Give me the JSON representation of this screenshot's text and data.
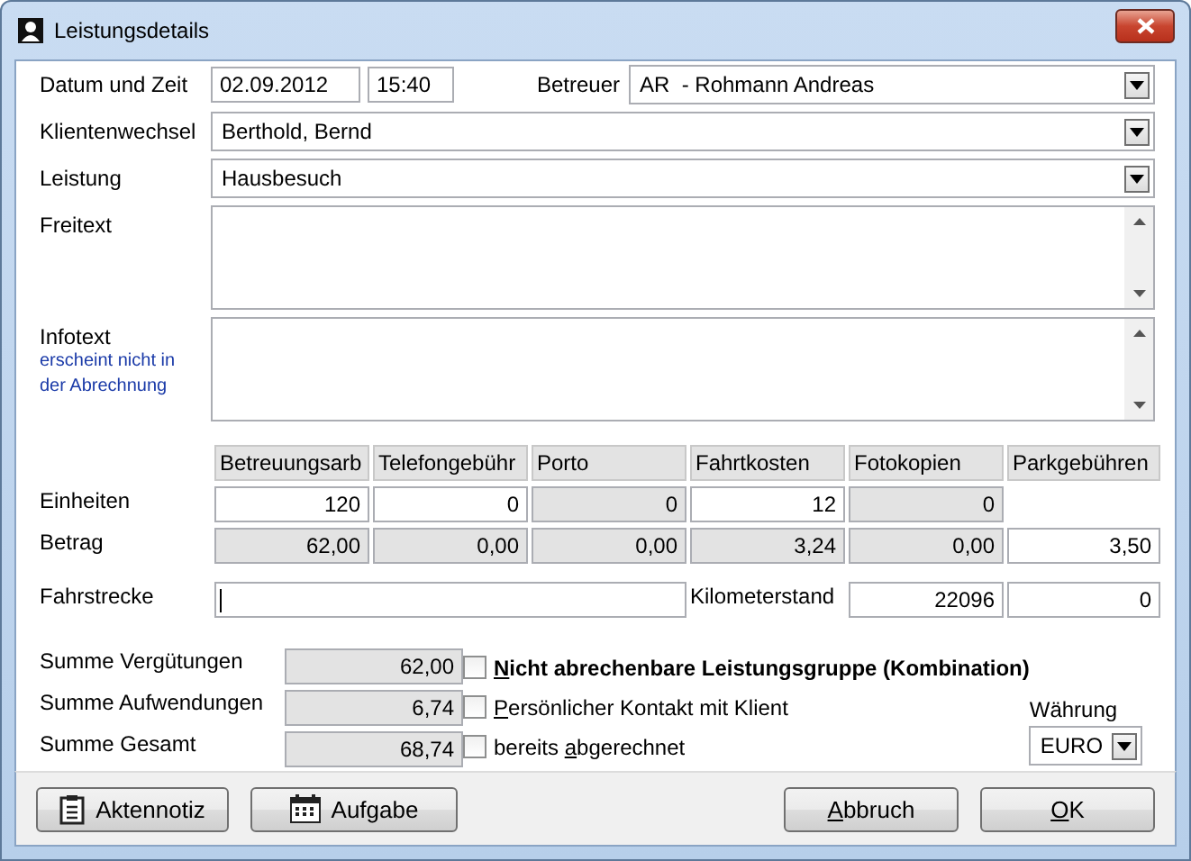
{
  "window": {
    "title": "Leistungsdetails"
  },
  "datetime": {
    "label": "Datum und Zeit",
    "date": "02.09.2012",
    "time": "15:40"
  },
  "betreuer": {
    "label": "Betreuer",
    "value": "AR  - Rohmann Andreas"
  },
  "klientenwechsel": {
    "label": "Klientenwechsel",
    "value": "Berthold, Bernd"
  },
  "leistung": {
    "label": "Leistung",
    "value": "Hausbesuch"
  },
  "freitext": {
    "label": "Freitext"
  },
  "infotext": {
    "label": "Infotext",
    "note": "erscheint nicht in der Abrechnung"
  },
  "cost_table": {
    "row_labels": [
      "Einheiten",
      "Betrag"
    ],
    "columns": [
      {
        "heading": "Betreuungsarb",
        "units": {
          "value": "120",
          "disabled": false
        },
        "amount": {
          "value": "62,00",
          "disabled": true
        }
      },
      {
        "heading": "Telefongebühr",
        "units": {
          "value": "0",
          "disabled": false
        },
        "amount": {
          "value": "0,00",
          "disabled": true
        }
      },
      {
        "heading": "Porto",
        "units": {
          "value": "0",
          "disabled": true
        },
        "amount": {
          "value": "0,00",
          "disabled": true
        }
      },
      {
        "heading": "Fahrtkosten",
        "units": {
          "value": "12",
          "disabled": false
        },
        "amount": {
          "value": "3,24",
          "disabled": true
        }
      },
      {
        "heading": "Fotokopien",
        "units": {
          "value": "0",
          "disabled": true
        },
        "amount": {
          "value": "0,00",
          "disabled": true
        }
      },
      {
        "heading": "Parkgebühren",
        "amount": {
          "value": "3,50",
          "disabled": false
        }
      }
    ]
  },
  "fahrstrecke": {
    "label": "Fahrstrecke",
    "focused": true
  },
  "kilometerstand": {
    "label": "Kilometerstand",
    "value": "22096",
    "value_2": "0"
  },
  "summen": [
    {
      "label": "Summe Vergütungen",
      "value": "62,00"
    },
    {
      "label": "Summe Aufwendungen",
      "value": "6,74"
    },
    {
      "label": "Summe Gesamt",
      "value": "68,74"
    }
  ],
  "checkboxes": [
    {
      "key": "N",
      "after": "icht abrechenbare Leistungsgruppe (Kombination)",
      "checked": false
    },
    {
      "key": "P",
      "after": "ersönlicher Kontakt mit Klient",
      "checked": false
    },
    {
      "before": "bereits ",
      "key": "a",
      "after": "bgerechnet",
      "checked": false
    }
  ],
  "waehrung": {
    "label": "Währung",
    "value": "EURO"
  },
  "buttons": [
    {
      "kind": "clipboard",
      "label": "Aktennotiz"
    },
    {
      "kind": "calendar",
      "label": "Aufgabe"
    },
    {
      "kind": "spacer"
    },
    {
      "kind": "plain",
      "key": "A",
      "after": "bbruch"
    },
    {
      "kind": "plain",
      "key": "O",
      "after": "K"
    }
  ]
}
